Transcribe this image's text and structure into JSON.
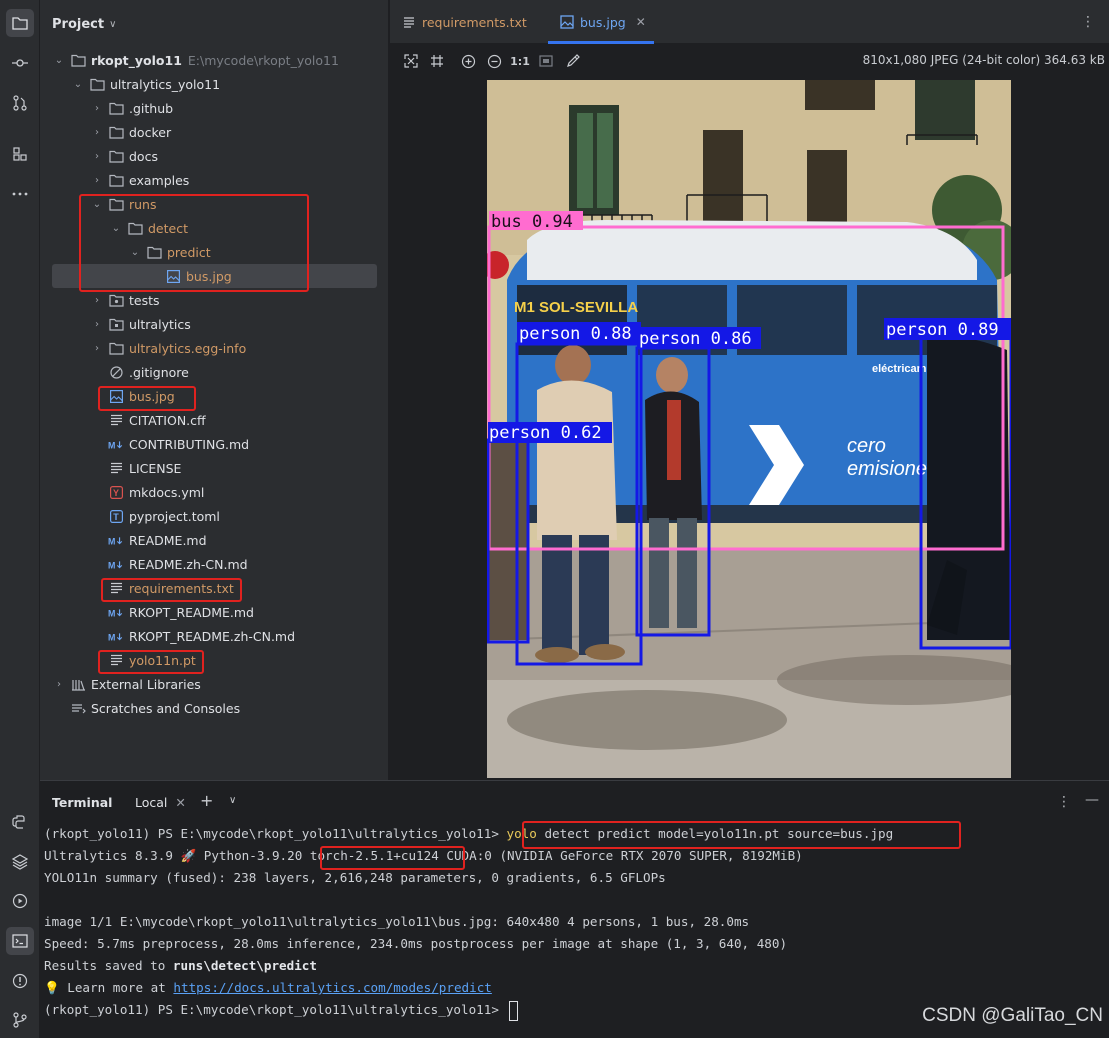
{
  "project": {
    "title": "Project",
    "tree": [
      {
        "label": "rkopt_yolo11",
        "hint": "E:\\mycode\\rkopt_yolo11"
      },
      {
        "label": "ultralytics_yolo11"
      },
      {
        "label": ".github"
      },
      {
        "label": "docker"
      },
      {
        "label": "docs"
      },
      {
        "label": "examples"
      },
      {
        "label": "runs"
      },
      {
        "label": "detect"
      },
      {
        "label": "predict"
      },
      {
        "label": "bus.jpg"
      },
      {
        "label": "tests"
      },
      {
        "label": "ultralytics"
      },
      {
        "label": "ultralytics.egg-info"
      },
      {
        "label": ".gitignore"
      },
      {
        "label": "bus.jpg"
      },
      {
        "label": "CITATION.cff"
      },
      {
        "label": "CONTRIBUTING.md"
      },
      {
        "label": "LICENSE"
      },
      {
        "label": "mkdocs.yml"
      },
      {
        "label": "pyproject.toml"
      },
      {
        "label": "README.md"
      },
      {
        "label": "README.zh-CN.md"
      },
      {
        "label": "requirements.txt"
      },
      {
        "label": "RKOPT_README.md"
      },
      {
        "label": "RKOPT_README.zh-CN.md"
      },
      {
        "label": "yolo11n.pt"
      },
      {
        "label": "External Libraries"
      },
      {
        "label": "Scratches and Consoles"
      }
    ]
  },
  "editor": {
    "tabs": [
      {
        "label": "requirements.txt"
      },
      {
        "label": "bus.jpg"
      }
    ],
    "zoom_label": "1:1",
    "image_info": "810x1,080 JPEG (24-bit color) 364.63 kB"
  },
  "detections": {
    "bus": "bus 0.94",
    "p1": "person 0.88",
    "p2": "person 0.86",
    "p3": "person 0.89",
    "p4": "person 0.62",
    "sign_text_1": "M1 SOL-SEVILLA",
    "sign_text_2": "cero",
    "sign_text_3": "emisiones",
    "sign_text_4": "eléctricamEMTe"
  },
  "terminal": {
    "title": "Terminal",
    "tab": "Local",
    "lines": {
      "l1_prompt": "(rkopt_yolo11) PS E:\\mycode\\rkopt_yolo11\\ultralytics_yolo11> ",
      "l1_cmd_yolo": "yolo",
      "l1_cmd_rest": " detect predict model=yolo11n.pt source=bus.jpg",
      "l2_a": "Ultralytics 8.3.9 🚀 Python-3.9.20 ",
      "l2_torch": "torch-2.5.1+cu124",
      "l2_b": " CUDA:0 (NVIDIA GeForce RTX 2070 SUPER, 8192MiB)",
      "l3": "YOLO11n summary (fused): 238 layers, 2,616,248 parameters, 0 gradients, 6.5 GFLOPs",
      "l5": "image 1/1 E:\\mycode\\rkopt_yolo11\\ultralytics_yolo11\\bus.jpg: 640x480 4 persons, 1 bus, 28.0ms",
      "l6": "Speed: 5.7ms preprocess, 28.0ms inference, 234.0ms postprocess per image at shape (1, 3, 640, 480)",
      "l7_a": "Results saved to ",
      "l7_b": "runs\\detect\\predict",
      "l8_a": "💡 Learn more at ",
      "l8_link": "https://docs.ultralytics.com/modes/predict",
      "l9": "(rkopt_yolo11) PS E:\\mycode\\rkopt_yolo11\\ultralytics_yolo11> "
    }
  },
  "watermark": "CSDN @GaliTao_CN"
}
